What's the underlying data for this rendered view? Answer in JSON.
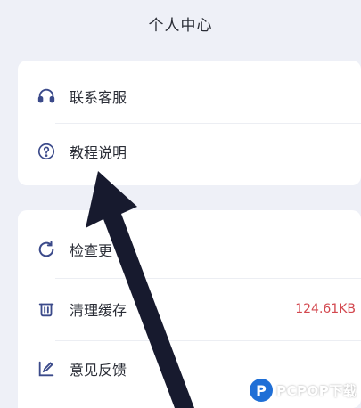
{
  "header": {
    "title": "个人中心"
  },
  "card1": {
    "items": [
      {
        "label": "联系客服",
        "icon": "headset-icon"
      },
      {
        "label": "教程说明",
        "icon": "question-icon"
      }
    ]
  },
  "card2": {
    "items": [
      {
        "label": "检查更",
        "icon": "refresh-icon"
      },
      {
        "label": "清理缓存",
        "icon": "trash-icon",
        "value": "124.61KB"
      },
      {
        "label": "意见反馈",
        "icon": "edit-icon"
      }
    ]
  },
  "watermark": {
    "text": "PCPOP下载"
  },
  "colors": {
    "accent": "#d3484f",
    "background": "#eef0f7",
    "watermark_blue": "#1f6fd6"
  }
}
